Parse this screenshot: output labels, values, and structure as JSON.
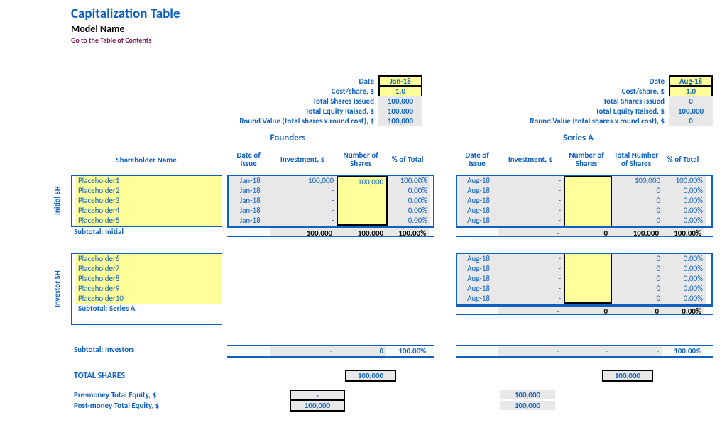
{
  "header": {
    "title": "Capitalization Table",
    "subtitle": "Model Name",
    "toc": "Go to the Table of Contents"
  },
  "summary_labels": {
    "date": "Date",
    "cost": "Cost/share, $",
    "shares": "Total Shares Issued",
    "equity": "Total Equity Raised, $",
    "round": "Round Value (total shares x round cost), $"
  },
  "founders": {
    "section": "Founders",
    "date": "Jan-18",
    "cost": "1.0",
    "shares": "100,000",
    "equity": "100,000",
    "round": "100,000"
  },
  "seriesA": {
    "section": "Series A",
    "date": "Aug-18",
    "cost": "1.0",
    "shares": "0",
    "equity": "100,000",
    "round": "0"
  },
  "columns": {
    "shareholder": "Shareholder Name",
    "date": "Date of Issue",
    "investment": "Investment, $",
    "shares": "Number of Shares",
    "total_shares": "Total Number of Shares",
    "pct": "% of Total"
  },
  "groups": {
    "initial_label": "Initial SH",
    "investor_label": "Investor SH"
  },
  "initial": [
    {
      "name": "Placeholder1",
      "f_date": "Jan-18",
      "f_inv": "100,000",
      "f_sh": "100,000",
      "f_pct": "100.00%",
      "a_date": "Aug-18",
      "a_inv": "-",
      "a_sh": "",
      "a_tot": "100,000",
      "a_pct": "100.00%"
    },
    {
      "name": "Placeholder2",
      "f_date": "Jan-18",
      "f_inv": "-",
      "f_sh": "",
      "f_pct": "0.00%",
      "a_date": "Aug-18",
      "a_inv": "-",
      "a_sh": "",
      "a_tot": "0",
      "a_pct": "0.00%"
    },
    {
      "name": "Placeholder3",
      "f_date": "Jan-18",
      "f_inv": "-",
      "f_sh": "",
      "f_pct": "0.00%",
      "a_date": "Aug-18",
      "a_inv": "-",
      "a_sh": "",
      "a_tot": "0",
      "a_pct": "0.00%"
    },
    {
      "name": "Placeholder4",
      "f_date": "Jan-18",
      "f_inv": "-",
      "f_sh": "",
      "f_pct": "0.00%",
      "a_date": "Aug-18",
      "a_inv": "-",
      "a_sh": "",
      "a_tot": "0",
      "a_pct": "0.00%"
    },
    {
      "name": "Placeholder5",
      "f_date": "Jan-18",
      "f_inv": "-",
      "f_sh": "",
      "f_pct": "0.00%",
      "a_date": "Aug-18",
      "a_inv": "-",
      "a_sh": "",
      "a_tot": "0",
      "a_pct": "0.00%"
    }
  ],
  "initial_sub": {
    "label": "Subtotal: Initial",
    "f_inv": "100,000",
    "f_sh": "100,000",
    "f_pct": "100.00%",
    "a_inv": "-",
    "a_sh": "0",
    "a_tot": "100,000",
    "a_pct": "100.00%"
  },
  "investors": [
    {
      "name": "Placeholder6",
      "a_date": "Aug-18",
      "a_inv": "-",
      "a_sh": "",
      "a_tot": "0",
      "a_pct": "0.00%"
    },
    {
      "name": "Placeholder7",
      "a_date": "Aug-18",
      "a_inv": "-",
      "a_sh": "",
      "a_tot": "0",
      "a_pct": "0.00%"
    },
    {
      "name": "Placeholder8",
      "a_date": "Aug-18",
      "a_inv": "-",
      "a_sh": "",
      "a_tot": "0",
      "a_pct": "0.00%"
    },
    {
      "name": "Placeholder9",
      "a_date": "Aug-18",
      "a_inv": "-",
      "a_sh": "",
      "a_tot": "0",
      "a_pct": "0.00%"
    },
    {
      "name": "Placeholder10",
      "a_date": "Aug-18",
      "a_inv": "-",
      "a_sh": "",
      "a_tot": "0",
      "a_pct": "0.00%"
    }
  ],
  "seriesA_sub": {
    "label": "Subtotal: Series A",
    "a_inv": "-",
    "a_sh": "0",
    "a_tot": "0",
    "a_pct": "0.00%"
  },
  "investors_sub": {
    "label": "Subtotal: Investors",
    "f_inv": "-",
    "f_sh": "0",
    "f_pct": "100.00%",
    "a_inv": "-",
    "a_sh": "-",
    "a_tot": "-",
    "a_pct": "100.00%"
  },
  "totals": {
    "shares_label": "TOTAL SHARES",
    "f_shares": "100,000",
    "a_shares": "100,000",
    "pre_label": "Pre-money Total Equity, $",
    "post_label": "Post-money Total Equity, $",
    "f_pre": "-",
    "f_post": "100,000",
    "a_pre": "100,000",
    "a_post": "100,000"
  }
}
